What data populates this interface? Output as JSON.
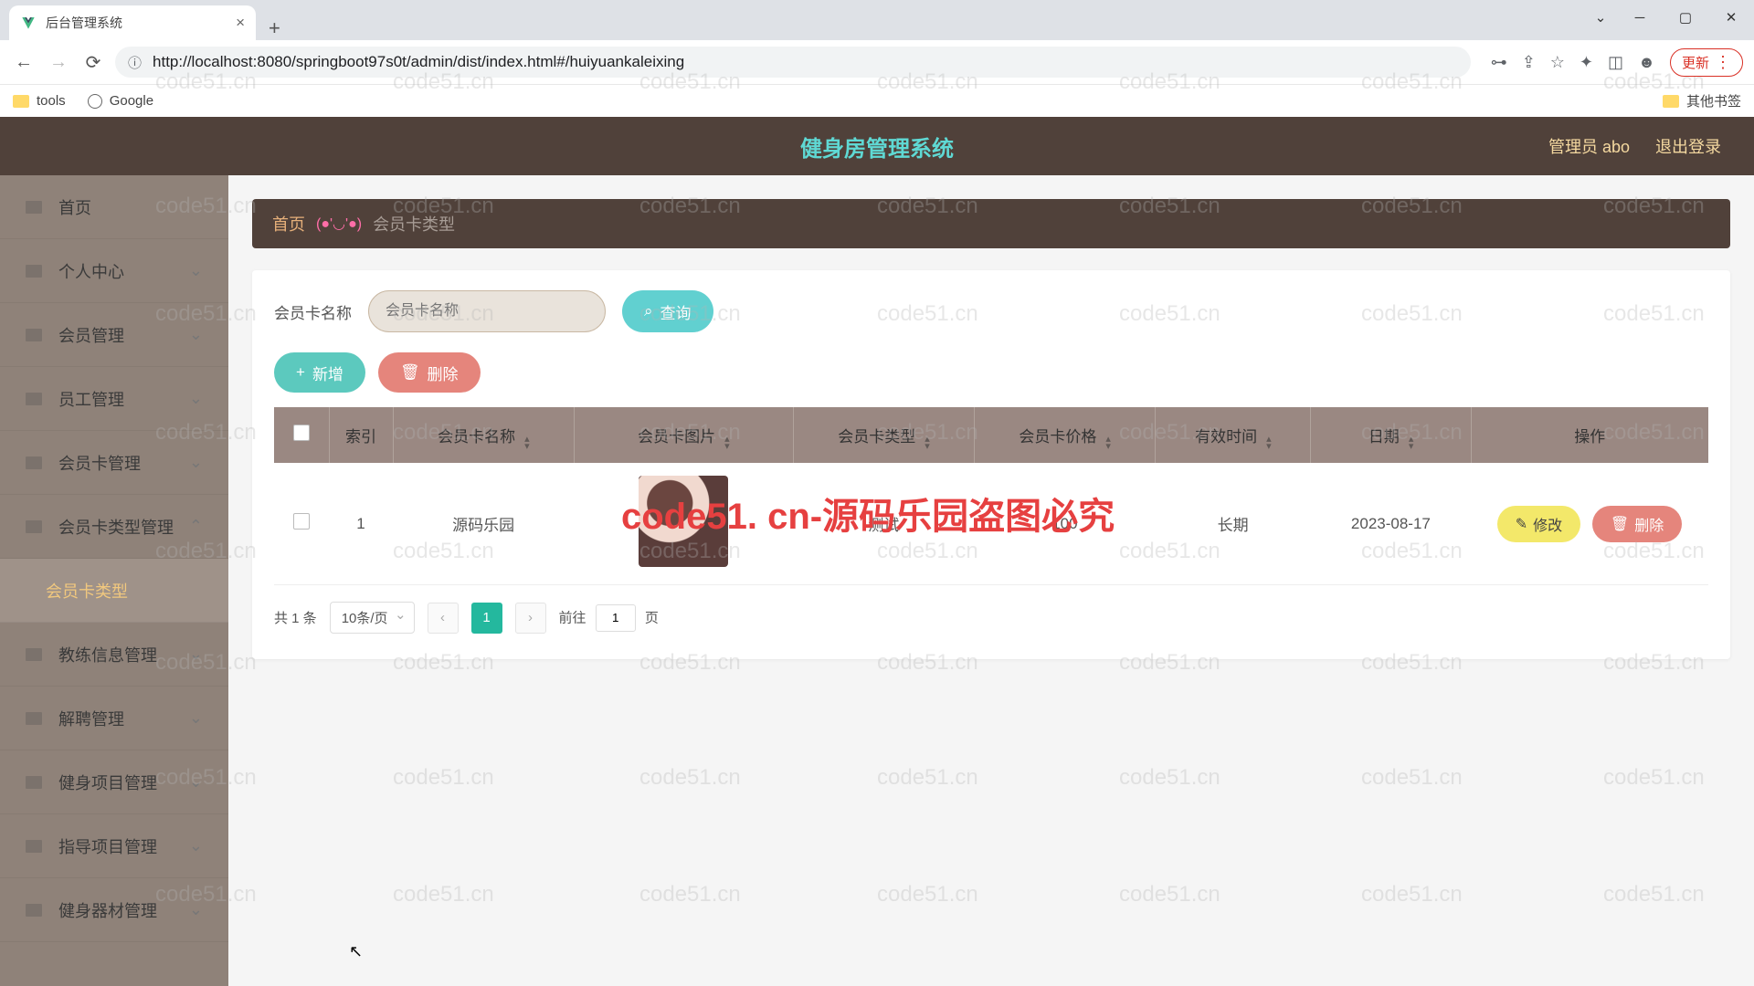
{
  "browser": {
    "tab_title": "后台管理系统",
    "url": "http://localhost:8080/springboot97s0t/admin/dist/index.html#/huiyuankaleixing",
    "update_label": "更新",
    "bookmarks": {
      "tools": "tools",
      "google": "Google",
      "other": "其他书签"
    }
  },
  "header": {
    "title": "健身房管理系统",
    "admin": "管理员 abo",
    "logout": "退出登录"
  },
  "sidebar": {
    "items": [
      "首页",
      "个人中心",
      "会员管理",
      "员工管理",
      "会员卡管理",
      "会员卡类型管理",
      "教练信息管理",
      "解聘管理",
      "健身项目管理",
      "指导项目管理",
      "健身器材管理"
    ],
    "active_sub": "会员卡类型"
  },
  "breadcrumb": {
    "home": "首页",
    "emoji": "(●'◡'●)",
    "current": "会员卡类型"
  },
  "search": {
    "label": "会员卡名称",
    "placeholder": "会员卡名称",
    "button": "查询"
  },
  "actions": {
    "add": "新增",
    "delete": "删除"
  },
  "table": {
    "headers": [
      "索引",
      "会员卡名称",
      "会员卡图片",
      "会员卡类型",
      "会员卡价格",
      "有效时间",
      "日期",
      "操作"
    ],
    "rows": [
      {
        "index": "1",
        "name": "源码乐园",
        "type": "测试",
        "price": "100",
        "validity": "长期",
        "date": "2023-08-17"
      }
    ],
    "op_edit": "修改",
    "op_delete": "删除"
  },
  "pagination": {
    "total": "共 1 条",
    "page_size": "10条/页",
    "current": "1",
    "goto_prefix": "前往",
    "goto_value": "1",
    "goto_suffix": "页"
  },
  "watermark": {
    "text": "code51.cn",
    "red": "code51. cn-源码乐园盗图必究"
  }
}
